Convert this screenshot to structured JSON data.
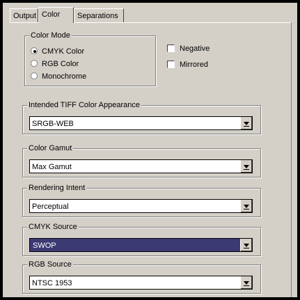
{
  "tabs": [
    {
      "label": "Output"
    },
    {
      "label": "Color"
    },
    {
      "label": "Separations"
    }
  ],
  "color_mode": {
    "title": "Color Mode",
    "options": [
      {
        "label": "CMYK Color",
        "selected": true
      },
      {
        "label": "RGB Color",
        "selected": false
      },
      {
        "label": "Monochrome",
        "selected": false
      }
    ]
  },
  "checkboxes": [
    {
      "label": "Negative",
      "checked": false
    },
    {
      "label": "Mirrored",
      "checked": false
    }
  ],
  "groups": [
    {
      "title": "Intended TIFF Color Appearance",
      "value": "SRGB-WEB"
    },
    {
      "title": "Color Gamut",
      "value": "Max Gamut"
    },
    {
      "title": "Rendering Intent",
      "value": "Perceptual"
    },
    {
      "title": "CMYK Source",
      "value": "SWOP"
    },
    {
      "title": "RGB Source",
      "value": "NTSC 1953"
    }
  ],
  "colors": {
    "selected_highlight": "#3c3a73"
  }
}
